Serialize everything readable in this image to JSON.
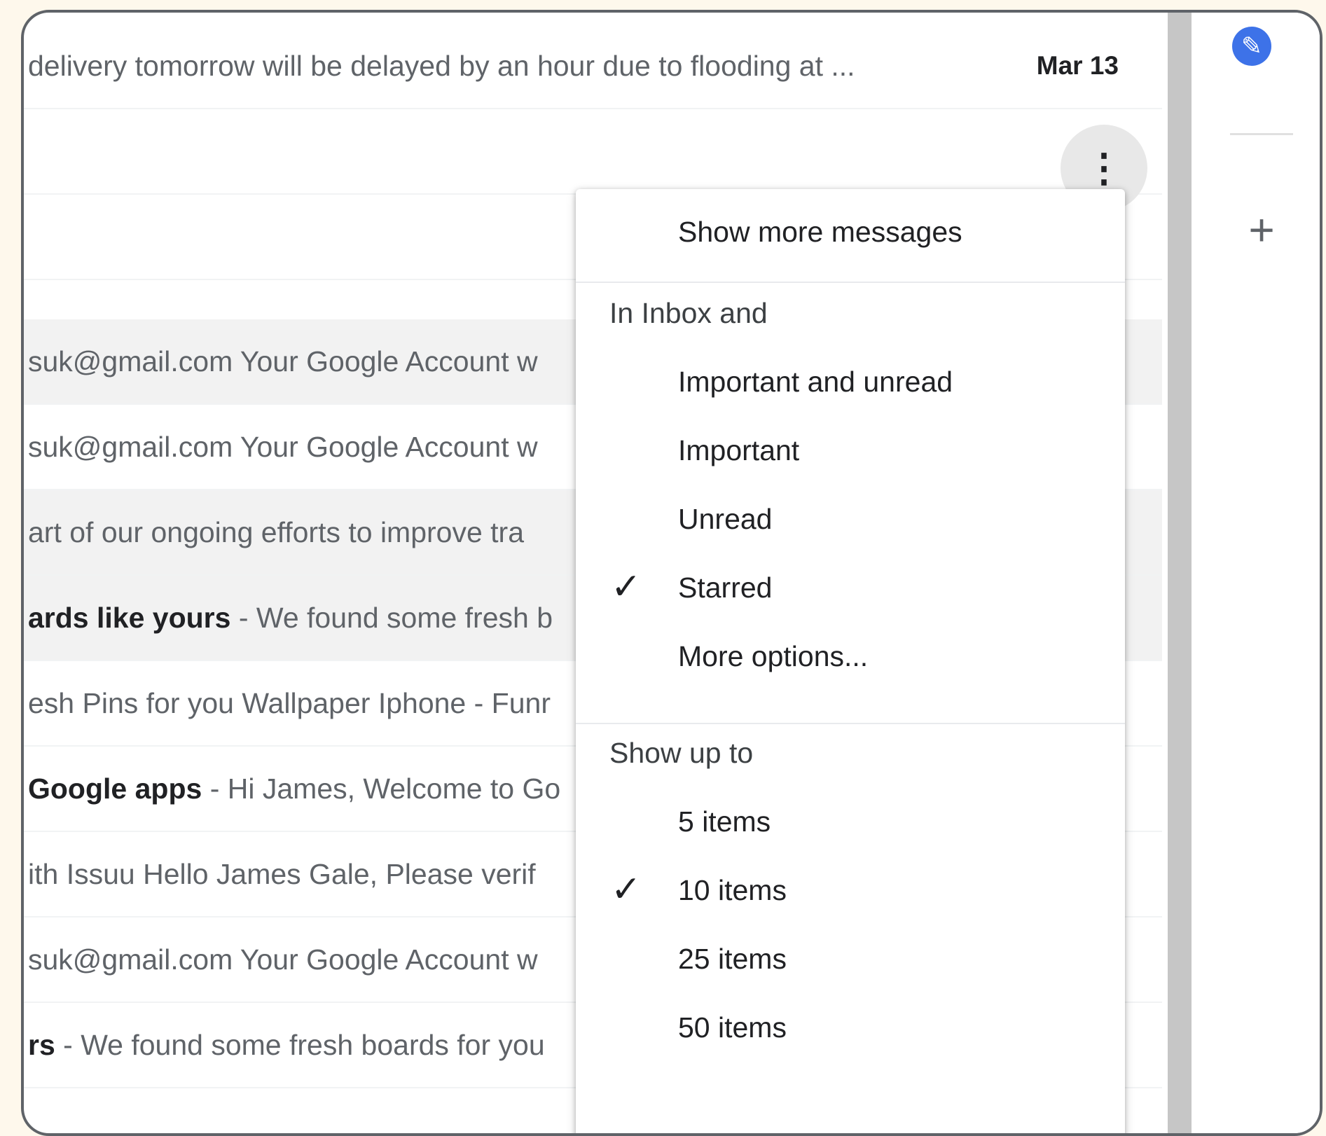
{
  "email_rows": [
    {
      "text": "delivery tomorrow will be delayed by an hour due to flooding at ...",
      "date": "Mar 13"
    },
    {
      "text": "",
      "date": ""
    },
    {
      "text": "",
      "date": ""
    },
    {
      "bold": "",
      "text": "suk@gmail.com Your Google Account w"
    },
    {
      "bold": "",
      "text": "suk@gmail.com Your Google Account w"
    },
    {
      "bold": "",
      "text": "art of our ongoing efforts to improve tra"
    },
    {
      "bold": "ards like yours",
      "text": " - We found some fresh b"
    },
    {
      "bold": "",
      "text": "esh Pins for you Wallpaper Iphone - Funr"
    },
    {
      "bold": "Google apps",
      "text": " - Hi James, Welcome to Go"
    },
    {
      "bold": "",
      "text": "ith Issuu Hello James Gale, Please verif"
    },
    {
      "bold": "",
      "text": "suk@gmail.com Your Google Account w"
    },
    {
      "bold": "rs",
      "text": " - We found some fresh boards for you"
    }
  ],
  "menu": {
    "show_more": "Show more messages",
    "inbox_header": "In Inbox and",
    "filters": [
      "Important and unread",
      "Important",
      "Unread",
      "Starred",
      "More options..."
    ],
    "selected_filter": "Starred",
    "show_header": "Show up to",
    "counts": [
      "5 items",
      "10 items",
      "25 items",
      "50 items"
    ],
    "selected_count": "10 items"
  },
  "icons": {
    "more": "more-vert-icon",
    "side_app": "tasks-icon",
    "side_add": "plus-icon",
    "check": "checkmark-icon"
  },
  "colors": {
    "accent": "#3d72e8",
    "selected_row": "#f2f2f2"
  }
}
